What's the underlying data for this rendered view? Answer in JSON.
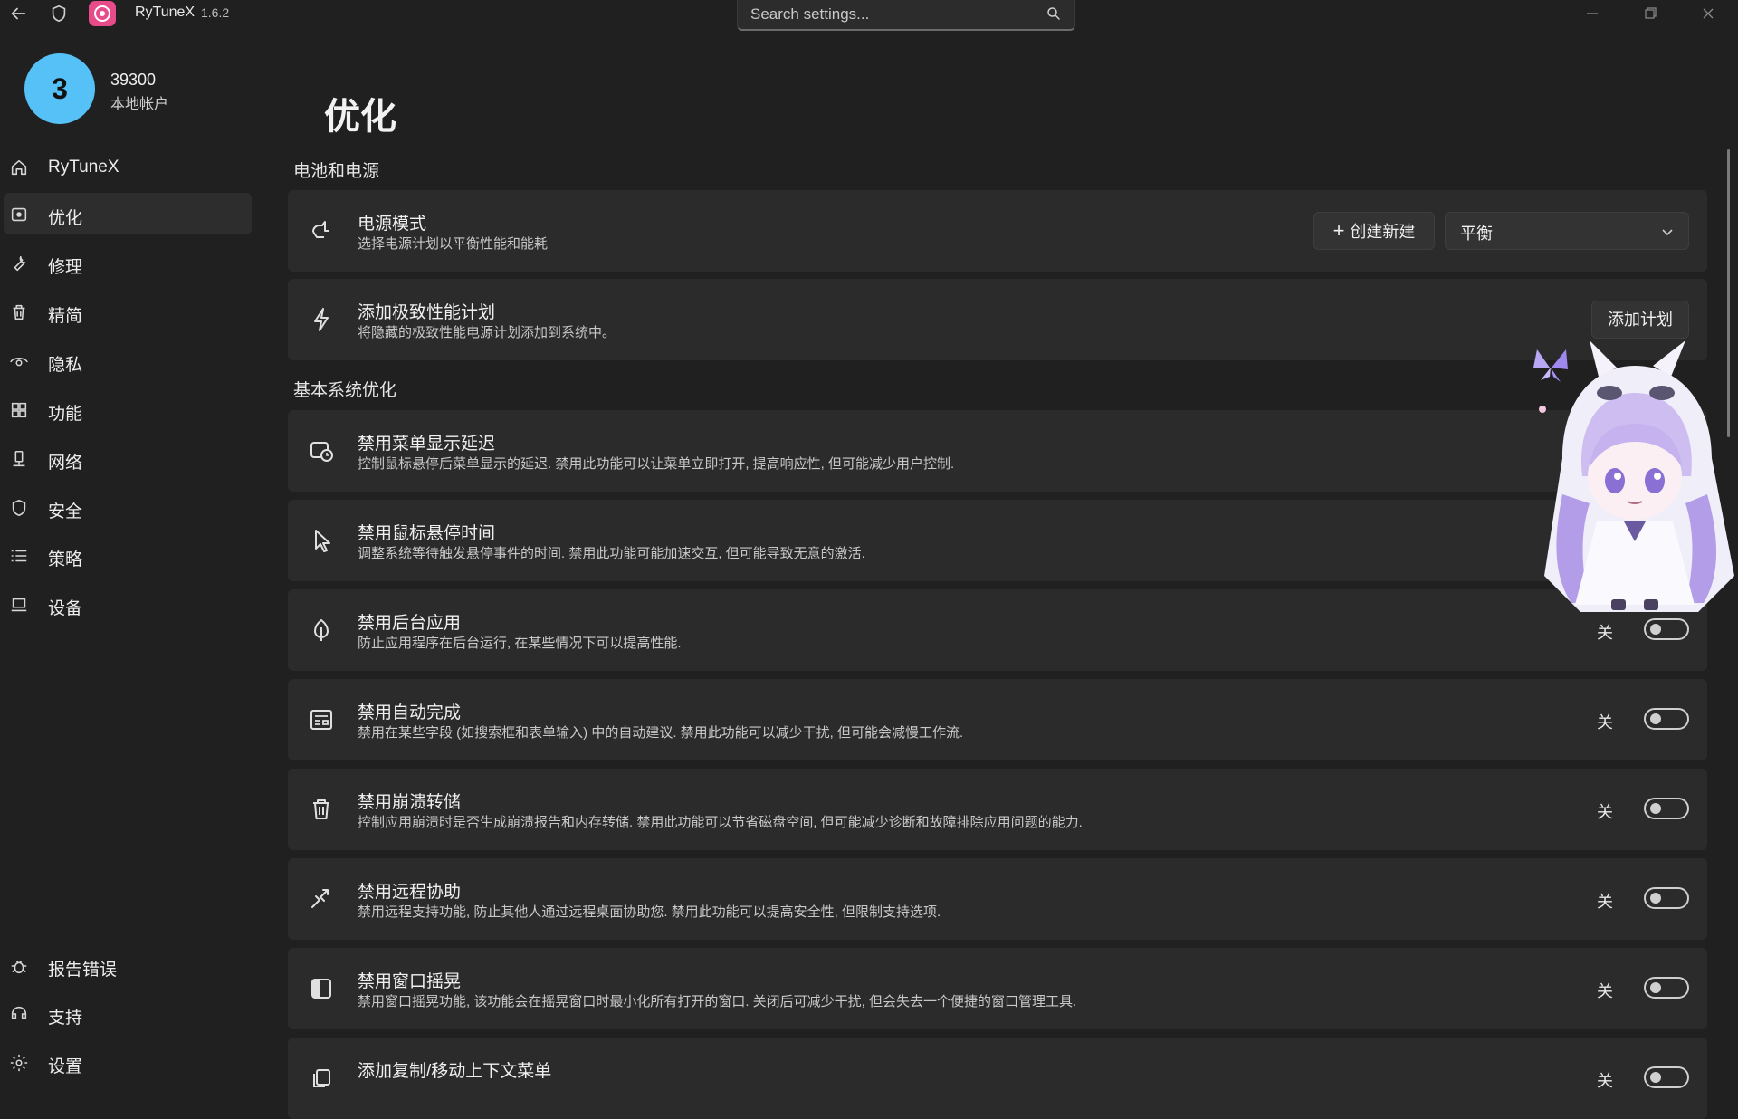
{
  "window": {
    "app_name": "RyTuneX",
    "version": "1.6.2"
  },
  "search": {
    "placeholder": "Search settings..."
  },
  "account": {
    "avatar_letter": "3",
    "name": "39300",
    "type": "本地帐户"
  },
  "nav": {
    "items": [
      {
        "label": "RyTuneX",
        "icon": "home-icon"
      },
      {
        "label": "优化",
        "icon": "optimize-icon",
        "active": true
      },
      {
        "label": "修理",
        "icon": "wrench-icon"
      },
      {
        "label": "精简",
        "icon": "trash-icon"
      },
      {
        "label": "隐私",
        "icon": "eye-icon"
      },
      {
        "label": "功能",
        "icon": "grid-icon"
      },
      {
        "label": "网络",
        "icon": "network-icon"
      },
      {
        "label": "安全",
        "icon": "shield-icon"
      },
      {
        "label": "策略",
        "icon": "list-icon"
      },
      {
        "label": "设备",
        "icon": "laptop-icon"
      }
    ],
    "footer": [
      {
        "label": "报告错误",
        "icon": "bug-icon"
      },
      {
        "label": "支持",
        "icon": "support-icon"
      },
      {
        "label": "设置",
        "icon": "settings-gear-icon"
      }
    ]
  },
  "page": {
    "title": "优化"
  },
  "sections": {
    "battery": {
      "title": "电池和电源"
    },
    "basic": {
      "title": "基本系统优化"
    }
  },
  "power_mode": {
    "title": "电源模式",
    "desc": "选择电源计划以平衡性能和能耗",
    "create_label": "创建新建",
    "selected": "平衡"
  },
  "ultimate_plan": {
    "title": "添加极致性能计划",
    "desc": "将隐藏的极致性能电源计划添加到系统中。",
    "button": "添加计划"
  },
  "settings": [
    {
      "title": "禁用菜单显示延迟",
      "desc": "控制鼠标悬停后菜单显示的延迟. 禁用此功能可以让菜单立即打开, 提高响应性, 但可能减少用户控制.",
      "toggle_label": "",
      "state": "off"
    },
    {
      "title": "禁用鼠标悬停时间",
      "desc": "调整系统等待触发悬停事件的时间. 禁用此功能可能加速交互, 但可能导致无意的激活.",
      "toggle_label": "",
      "state": "off"
    },
    {
      "title": "禁用后台应用",
      "desc": "防止应用程序在后台运行, 在某些情况下可以提高性能.",
      "toggle_label": "关",
      "state": "off"
    },
    {
      "title": "禁用自动完成",
      "desc": "禁用在某些字段 (如搜索框和表单输入) 中的自动建议. 禁用此功能可以减少干扰, 但可能会减慢工作流.",
      "toggle_label": "关",
      "state": "off"
    },
    {
      "title": "禁用崩溃转储",
      "desc": "控制应用崩溃时是否生成崩溃报告和内存转储. 禁用此功能可以节省磁盘空间, 但可能减少诊断和故障排除应用问题的能力.",
      "toggle_label": "关",
      "state": "off"
    },
    {
      "title": "禁用远程协助",
      "desc": "禁用远程支持功能, 防止其他人通过远程桌面协助您. 禁用此功能可以提高安全性, 但限制支持选项.",
      "toggle_label": "关",
      "state": "off"
    },
    {
      "title": "禁用窗口摇晃",
      "desc": "禁用窗口摇晃功能, 该功能会在摇晃窗口时最小化所有打开的窗口. 关闭后可减少干扰, 但会失去一个便捷的窗口管理工具.",
      "toggle_label": "关",
      "state": "off"
    },
    {
      "title": "添加复制/移动上下文菜单",
      "desc": "",
      "toggle_label": "关",
      "state": "off"
    }
  ]
}
